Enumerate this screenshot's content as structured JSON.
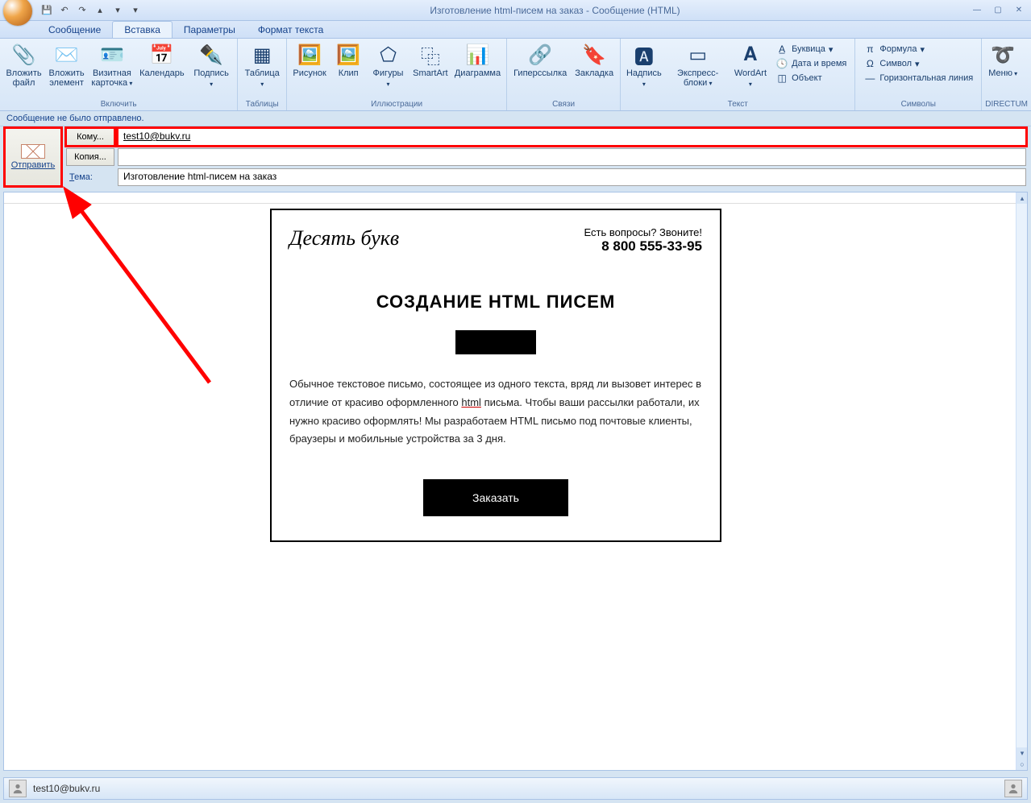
{
  "window": {
    "title": "Изготовление html-писем на заказ - Сообщение (HTML)"
  },
  "tabs": {
    "message": "Сообщение",
    "insert": "Вставка",
    "options": "Параметры",
    "format": "Формат текста"
  },
  "ribbon": {
    "include": {
      "label": "Включить",
      "attach_file": "Вложить\nфайл",
      "attach_item": "Вложить\nэлемент",
      "business_card": "Визитная\nкарточка",
      "calendar": "Календарь",
      "signature": "Подпись"
    },
    "tables": {
      "label": "Таблицы",
      "table": "Таблица"
    },
    "illustrations": {
      "label": "Иллюстрации",
      "picture": "Рисунок",
      "clip": "Клип",
      "shapes": "Фигуры",
      "smartart": "SmartArt",
      "chart": "Диаграмма"
    },
    "links": {
      "label": "Связи",
      "hyperlink": "Гиперссылка",
      "bookmark": "Закладка"
    },
    "text": {
      "label": "Текст",
      "textbox": "Надпись",
      "quickparts": "Экспресс-блоки",
      "wordart": "WordArt",
      "dropcap": "Буквица",
      "datetime": "Дата и время",
      "object": "Объект"
    },
    "symbols": {
      "label": "Символы",
      "formula": "Формула",
      "symbol": "Символ",
      "hrule": "Горизонтальная линия"
    },
    "directum": {
      "label": "DIRECTUM",
      "menu": "Меню"
    }
  },
  "notice": "Сообщение не было отправлено.",
  "compose": {
    "send": "Отправить",
    "to_btn": "Кому...",
    "cc_btn": "Копия...",
    "subject_label": "Тема:",
    "to_value": "test10@bukv.ru",
    "cc_value": "",
    "subject_value": "Изготовление html-писем на заказ"
  },
  "email": {
    "brand": "Десять букв",
    "contact_line": "Есть вопросы? Звоните!",
    "phone": "8 800 555-33-95",
    "heading": "СОЗДАНИЕ HTML ПИСЕМ",
    "body1": "Обычное текстовое письмо, состоящее из одного текста, вряд ли вызовет интерес в отличие от красиво оформленного ",
    "body_html": "html",
    "body2": " письма. Чтобы ваши рассылки работали, их нужно красиво оформлять! Мы разработаем HTML письмо под почтовые клиенты, браузеры и мобильные устройства за 3 дня.",
    "cta": "Заказать"
  },
  "status": {
    "email": "test10@bukv.ru"
  }
}
